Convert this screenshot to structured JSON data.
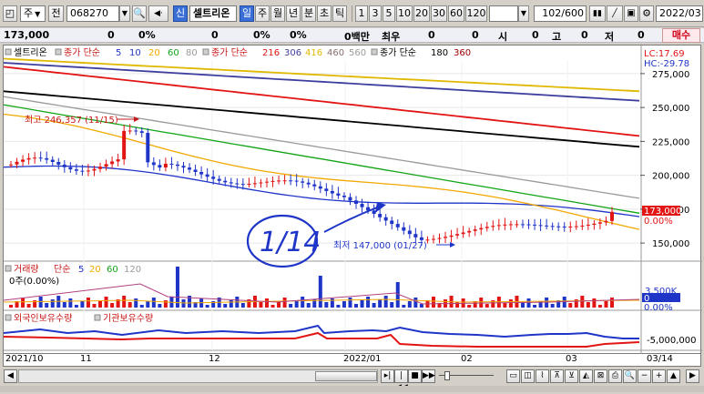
{
  "toolbar": {
    "type_label": "주",
    "jeon_label": "전",
    "code_value": "068270",
    "shin_label": "신",
    "stock_name": "셀트리온",
    "period_buttons": [
      "일",
      "주",
      "월",
      "년",
      "분",
      "초",
      "틱"
    ],
    "interval_buttons": [
      "1",
      "3",
      "5",
      "10",
      "20",
      "30",
      "60",
      "120"
    ],
    "count_value": "102",
    "count_total": "/600",
    "date_value": "2022/03"
  },
  "infobar": {
    "price": "173,000",
    "v1": "0",
    "p1": "0%",
    "v2": "0",
    "p2": "0%",
    "p3": "0%",
    "amount": "0백만",
    "qty_label": "최우",
    "qty_value": "0",
    "qty_value2": "0",
    "open_label": "시",
    "open_value": "0",
    "high_label": "고",
    "high_value": "0",
    "low_label": "저",
    "low_value": "0",
    "buy_label": "매수"
  },
  "colors": {
    "ma5": "#1f35c8",
    "ma10": "#1f35c8",
    "ma20": "#f2a800",
    "ma60": "#13a418",
    "ma80": "#9a9a9a",
    "ma216": "#e21515",
    "ma306": "#3e3e9e",
    "ma416": "#e0b800",
    "ma460": "#8a7070",
    "ma560": "#000000",
    "ma180": "#c0c0c0",
    "ma360": "#a00000",
    "up": "#e21515",
    "down": "#1f35c8",
    "current": "#e21515"
  },
  "legend": {
    "stock": "셀트리온",
    "simple1": "종가 단순",
    "p1": [
      "5",
      "10",
      "20",
      "60",
      "80"
    ],
    "simple2": "종가 단순",
    "p2": [
      "216",
      "306",
      "416",
      "460",
      "560"
    ],
    "simple3": "종가 단순",
    "p3": [
      "180",
      "360"
    ]
  },
  "price_panel": {
    "lc": "LC:17.69",
    "hc": "HC:-29.78",
    "y_ticks": [
      "275,000",
      "250,000",
      "225,000",
      "200,000",
      "175,000",
      "150,000"
    ],
    "current_price": "173,000",
    "current_pct": "0.00%",
    "max_annotation": "최고 246,357 (11/15)",
    "min_annotation": "최저 147,000 (01/27)",
    "handwriting": "1/14"
  },
  "volume_panel": {
    "title": "거래량",
    "simple": "단순",
    "periods": [
      "5",
      "20",
      "60",
      "120"
    ],
    "sub": "0주(0.00%)",
    "ticks": [
      "3,500K"
    ],
    "current": "0",
    "current_pct": "0.00%"
  },
  "holding_panel": {
    "title1": "외국인보유수량",
    "title2": "기관보유수량",
    "tick": "-5,000,000"
  },
  "x_axis": {
    "labels": [
      "2021/10",
      "11",
      "12",
      "2022/01",
      "02",
      "03",
      "03/14"
    ]
  },
  "chart_data": {
    "type": "candlestick",
    "title": "셀트리온",
    "x_range": [
      "2021/10",
      "2022/03/14"
    ],
    "y_range": [
      140000,
      285000
    ],
    "last_close": 173000,
    "max": {
      "value": 246357,
      "date": "11/15"
    },
    "min": {
      "value": 147000,
      "date": "01/27"
    },
    "moving_averages": [
      {
        "name": "종가 단순 5",
        "start": 206000,
        "end": 168000
      },
      {
        "name": "종가 단순 20",
        "start": 240000,
        "end": 162000
      },
      {
        "name": "종가 단순 60",
        "start": 252000,
        "end": 172000
      },
      {
        "name": "종가 단순 80",
        "start": 258000,
        "end": 183000
      },
      {
        "name": "종가 단순 216",
        "start": 280000,
        "end": 229000
      },
      {
        "name": "종가 단순 306",
        "start": 283000,
        "end": 255000
      },
      {
        "name": "종가 단순 416",
        "start": 286000,
        "end": 262000
      },
      {
        "name": "종가 단순 560",
        "start": 262000,
        "end": 221000
      }
    ]
  }
}
